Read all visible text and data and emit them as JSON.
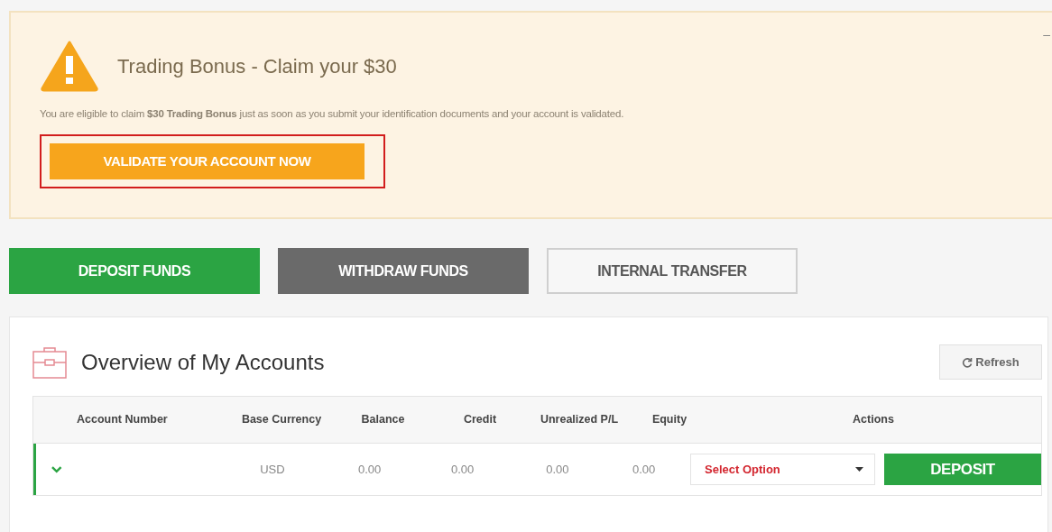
{
  "banner": {
    "title": "Trading Bonus - Claim your $30",
    "message": "You are eligible to claim **$30 Trading Bonus** just as soon as you submit your identification documents and your account is validated.",
    "collapse_label": "–",
    "button": {
      "label": "VALIDATE YOUR ACCOUNT NOW",
      "highlighted": true
    }
  },
  "fund_actions": [
    {
      "label": "DEPOSIT FUNDS",
      "kind": "green"
    },
    {
      "label": "WITHDRAW FUNDS",
      "kind": "dark"
    },
    {
      "label": "INTERNAL TRANSFER",
      "kind": "outline"
    }
  ],
  "overview": {
    "title": "Overview of My Accounts",
    "refresh_label": "Refresh",
    "table": {
      "columns": [
        "Account Number",
        "Base Currency",
        "Balance",
        "Credit",
        "Unrealized P/L",
        "Equity",
        "Actions"
      ],
      "rows": [
        {
          "account_number": "",
          "base_currency": "USD",
          "balance": "0.00",
          "credit": "0.00",
          "unrealized_pl": "0.00",
          "equity": "0.00",
          "action_select": "Select Option",
          "action_button": "DEPOSIT"
        }
      ]
    }
  }
}
